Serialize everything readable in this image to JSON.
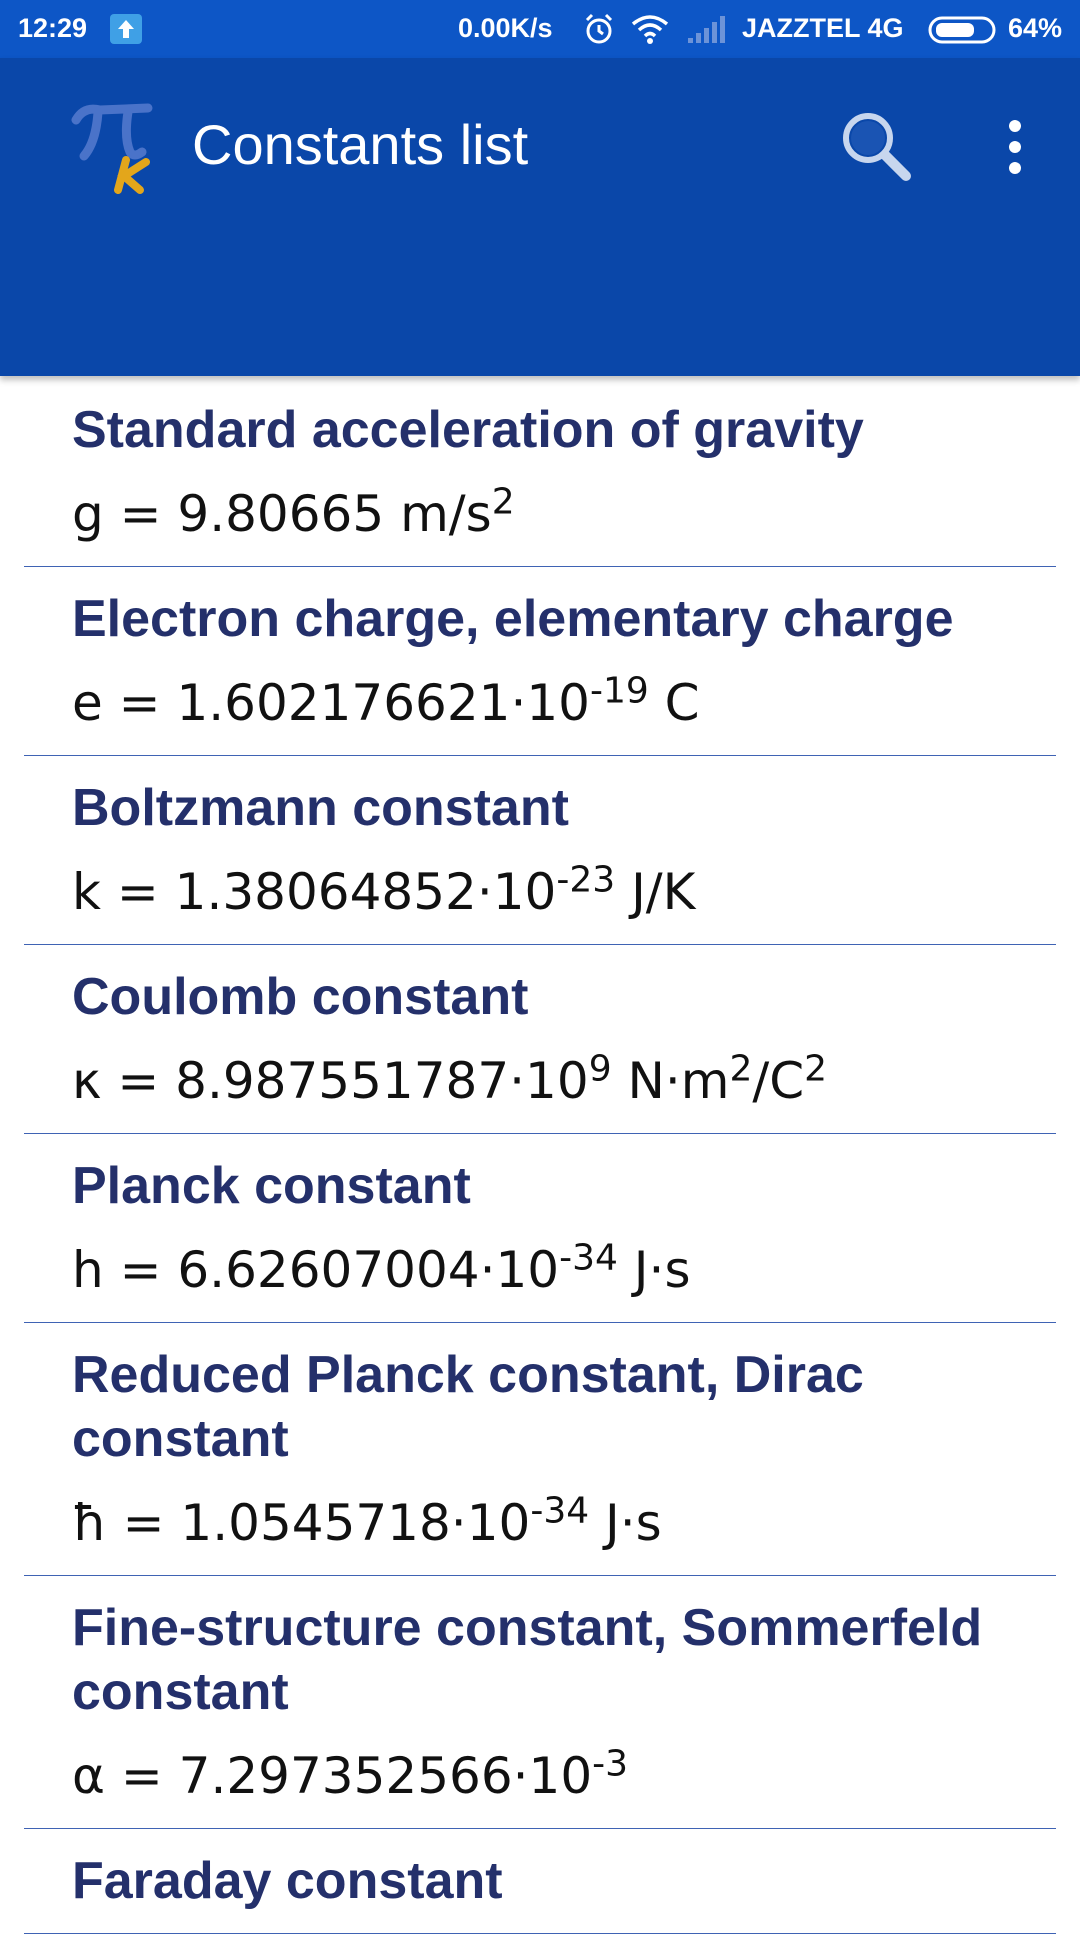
{
  "status_bar": {
    "time": "12:29",
    "network_speed": "0.00K/s",
    "carrier": "JAZZTEL 4G",
    "battery_percent": "64%"
  },
  "app_bar": {
    "title": "Constants list",
    "logo_icon": "pi-k-logo",
    "search_icon": "search-icon",
    "menu_icon": "more-vert-icon"
  },
  "colors": {
    "status_bar": "#0d56c6",
    "app_bar": "#0a47a9",
    "item_title": "#24306b",
    "divider": "#3f63b4"
  },
  "constants": [
    {
      "name": "Standard acceleration of gravity",
      "value": "g = 9.80665 m/s",
      "exp": "2",
      "unit": ""
    },
    {
      "name": "Electron charge, elementary charge",
      "value": "e = 1.602176621·10",
      "exp": "-19",
      "unit": " C"
    },
    {
      "name": "Boltzmann constant",
      "value": "k = 1.38064852·10",
      "exp": "-23",
      "unit": " J/K"
    },
    {
      "name": "Coulomb constant",
      "value": "κ = 8.987551787·10",
      "exp": "9",
      "unit": " N·m",
      "exp2": "2",
      "unit2": "/C",
      "exp3": "2"
    },
    {
      "name": "Planck constant",
      "value": "h = 6.62607004·10",
      "exp": "-34",
      "unit": " J·s"
    },
    {
      "name": "Reduced Planck constant, Dirac constant",
      "value": "ħ = 1.0545718·10",
      "exp": "-34",
      "unit": " J·s"
    },
    {
      "name": "Fine-structure constant, Sommerfeld constant",
      "value": "α = 7.297352566·10",
      "exp": "-3",
      "unit": ""
    },
    {
      "name": "Faraday constant",
      "value": "",
      "exp": "",
      "unit": ""
    }
  ]
}
